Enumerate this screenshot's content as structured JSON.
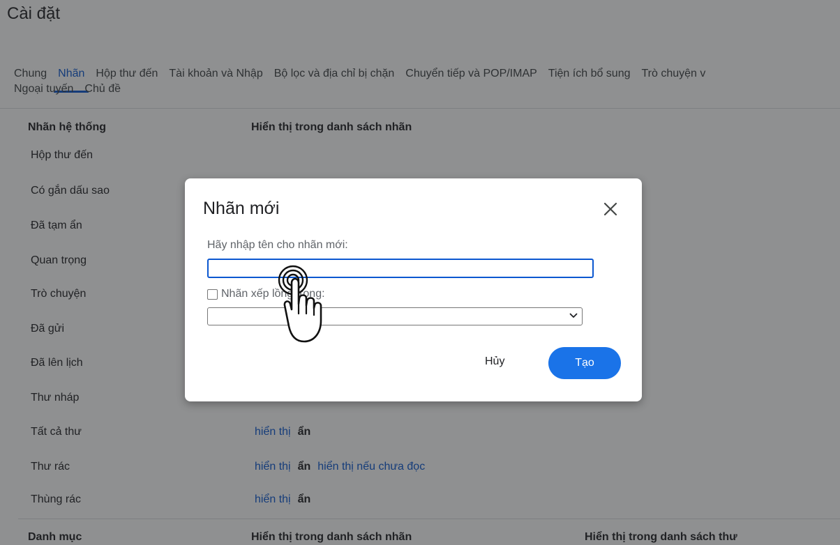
{
  "settings": {
    "title": "Cài đặt",
    "tabs_row1": [
      "Chung",
      "Nhãn",
      "Hộp thư đến",
      "Tài khoản và Nhập",
      "Bộ lọc và địa chỉ bị chặn",
      "Chuyển tiếp và POP/IMAP",
      "Tiện ích bổ sung",
      "Trò chuyện v"
    ],
    "tabs_row2": [
      "Ngoại tuyến",
      "Chủ đề"
    ],
    "active_tab": "Nhãn"
  },
  "system_labels": {
    "col_name": "Nhãn hệ thống",
    "col_show": "Hiển thị trong danh sách nhãn",
    "rows": [
      {
        "name": "Hộp thư đến"
      },
      {
        "name": "Có gắn dấu sao"
      },
      {
        "name": "Đã tạm ẩn"
      },
      {
        "name": "Quan trọng"
      },
      {
        "name": "Trò chuyện"
      },
      {
        "name": "Đã gửi"
      },
      {
        "name": "Đã lên lịch"
      },
      {
        "name": "Thư nháp"
      },
      {
        "name": "Tất cả thư",
        "show": "hiển thị",
        "hide": "ẩn"
      },
      {
        "name": "Thư rác",
        "show": "hiển thị",
        "hide": "ẩn",
        "unread": "hiển thị nếu chưa đọc"
      },
      {
        "name": "Thùng rác",
        "show": "hiển thị",
        "hide": "ẩn"
      }
    ]
  },
  "categories": {
    "col_name": "Danh mục",
    "col_show_labels": "Hiển thị trong danh sách nhãn",
    "col_show_messages": "Hiển thị trong danh sách thư"
  },
  "dialog": {
    "title": "Nhãn mới",
    "name_label": "Hãy nhập tên cho nhãn mới:",
    "name_value": "",
    "nest_label": "Nhãn xếp lồng trong:",
    "nest_checked": false,
    "parent_value": "",
    "cancel_label": "Hủy",
    "create_label": "Tạo"
  },
  "colors": {
    "accent": "#0b57d0",
    "primary_button": "#1a73e8"
  }
}
